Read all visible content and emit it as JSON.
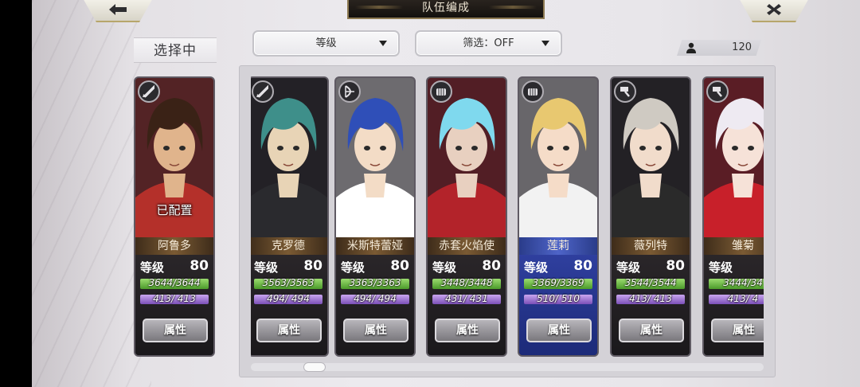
{
  "header": {
    "title": "队伍编成",
    "back_icon": "arrow-left-icon",
    "close_icon": "close-icon"
  },
  "selecting_label": "选择中",
  "dropdowns": {
    "sort": "等级",
    "filter": "筛选：OFF"
  },
  "count": "120",
  "selected_character": {
    "name": "阿鲁多",
    "status": "已配置",
    "level_label": "等级",
    "level": "80",
    "hp": "3644/3644",
    "mp": "413/ 413",
    "attr_button": "属性",
    "class_icon": "sword-icon",
    "palette": [
      "#3a2216",
      "#b4302a",
      "#e0b48c"
    ]
  },
  "characters": [
    {
      "name": "克罗德",
      "level_label": "等级",
      "level": "80",
      "hp": "3563/3563",
      "mp": "494/ 494",
      "attr_button": "属性",
      "class_icon": "sword-icon",
      "palette": [
        "#3e8f8a",
        "#2a2a2e",
        "#e8d4b6"
      ],
      "style": "dark"
    },
    {
      "name": "米斯特蕾娅",
      "level_label": "等级",
      "level": "80",
      "hp": "3363/3363",
      "mp": "494/ 494",
      "attr_button": "属性",
      "class_icon": "bow-icon",
      "palette": [
        "#2f4fb8",
        "#ffffff",
        "#f3dcc6"
      ],
      "style": "dark"
    },
    {
      "name": "赤套火焰使",
      "level_label": "等级",
      "level": "80",
      "hp": "3448/3448",
      "mp": "431/ 431",
      "attr_button": "属性",
      "class_icon": "fist-icon",
      "palette": [
        "#7fd9ee",
        "#b3232a",
        "#e8d0c0"
      ],
      "style": "dark"
    },
    {
      "name": "莲莉",
      "level_label": "等级",
      "level": "80",
      "hp": "3369/3369",
      "mp": "510/ 510",
      "attr_button": "属性",
      "class_icon": "fist-icon",
      "palette": [
        "#e8c870",
        "#f2f2f2",
        "#f5dcc8"
      ],
      "style": "blue"
    },
    {
      "name": "薇列特",
      "level_label": "等级",
      "level": "80",
      "hp": "3544/3544",
      "mp": "413/ 413",
      "attr_button": "属性",
      "class_icon": "hammer-icon",
      "palette": [
        "#cfcac2",
        "#2a2a2a",
        "#f1dccb"
      ],
      "style": "dark"
    },
    {
      "name": "雏菊",
      "level_label": "等级",
      "level": "8",
      "hp": "3444/34",
      "mp": "413/ 4",
      "attr_button": "属性",
      "class_icon": "hammer-icon",
      "palette": [
        "#eeeaf2",
        "#c8202a",
        "#f6e2d8"
      ],
      "style": "dark"
    }
  ]
}
